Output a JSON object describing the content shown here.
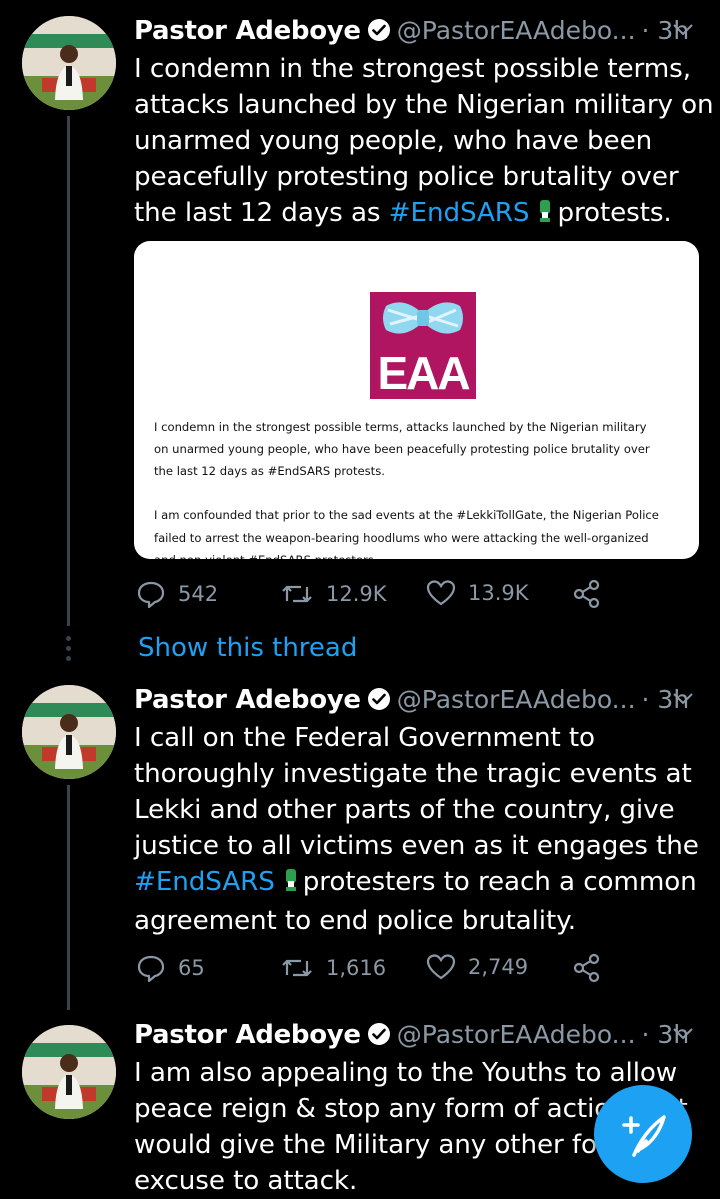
{
  "tweets": [
    {
      "name": "Pastor Adeboye",
      "handle": "@PastorEAAdebo...",
      "time": "· 3h",
      "text_before": "I condemn in the strongest possible terms, attacks launched by the Nigerian military on unarmed young people, who have been peacefully protesting police brutality over the last 12 days as ",
      "hashtag": "#EndSARS",
      "text_after": "protests.",
      "replies": "542",
      "retweets": "12.9K",
      "likes": "13.9K"
    },
    {
      "name": "Pastor Adeboye",
      "handle": "@PastorEAAdebo...",
      "time": "· 3h",
      "text_before": "I call on the Federal Government to thoroughly investigate the tragic events at Lekki and other parts of the country, give justice to all victims even as it engages the ",
      "hashtag": "#EndSARS",
      "text_after": "protesters to reach a common agreement to end police brutality.",
      "replies": "65",
      "retweets": "1,616",
      "likes": "2,749"
    },
    {
      "name": "Pastor Adeboye",
      "handle": "@PastorEAAdebo...",
      "time": "· 3h",
      "text_before": "I am also appealing to the Youths to allow peace reign & stop any form of action that would give the Military any other form of excuse to attack.",
      "hashtag": "",
      "text_after": ""
    }
  ],
  "media": {
    "logo_text": "EAA",
    "paragraph_1_line_1": "I condemn in the strongest possible terms, attacks launched by the Nigerian military",
    "paragraph_1_line_2": "on unarmed young people, who have been peacefully protesting police brutality over",
    "paragraph_1_line_3": "the last 12 days as #EndSARS protests.",
    "paragraph_2_line_1": "I am confounded that prior to the sad events at the #LekkiTollGate, the Nigerian Police",
    "paragraph_2_line_2": "failed to arrest  the weapon-bearing hoodlums who were attacking the well-organized",
    "paragraph_2_line_3": "and non-violent #EndSARS protesters"
  },
  "show_thread": "Show this thread",
  "colors": {
    "accent": "#1da1f2",
    "muted": "#8b98a5",
    "background": "#000000",
    "logo_bg": "#b01561"
  },
  "icons": [
    "verified-badge-icon",
    "chevron-down-icon",
    "reply-icon",
    "retweet-icon",
    "like-icon",
    "share-icon",
    "compose-tweet-icon",
    "raised-fist-emoji-icon"
  ]
}
